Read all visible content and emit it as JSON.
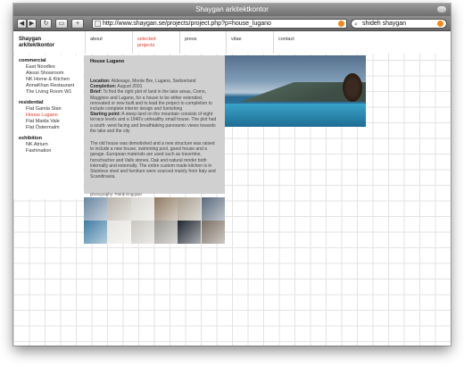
{
  "window": {
    "title": "Shaygan arkitektkontor"
  },
  "toolbar": {
    "back": "◀",
    "forward": "▶",
    "reload": "↻",
    "window_btn": "▭",
    "add": "+",
    "url": "http://www.shaygan.se/projects/project.php?p=house_lugano",
    "search": "shideh shaygan"
  },
  "nav": {
    "logo_line1": "Shaygan",
    "logo_line2": "arkitektkontor",
    "about": "about",
    "selected_line1": "selected",
    "selected_line2": "projects",
    "press": "press",
    "vitae": "vitae",
    "contact": "contact"
  },
  "sidebar": {
    "commercial": "commercial",
    "commercial_items": [
      "East Noodles",
      "Alessi Showroom",
      "NK Home & Kitchen",
      "AnnaKhan Restaurant",
      "The Living Room W1"
    ],
    "residential": "residential",
    "residential_items": [
      "Flat Gamla Stan",
      "House Lugano",
      "Flat Maida Vale",
      "Flat Östermalm"
    ],
    "exhibition": "exhibition",
    "exhibition_items": [
      "NK Atrium",
      "Fashination"
    ]
  },
  "project": {
    "title": "House Lugano",
    "location_label": "Location:",
    "location": "Aldesago, Monte Bre, Lugano, Switzerland",
    "completion_label": "Completion:",
    "completion": "August 2001",
    "brief_label": "Brief:",
    "brief": "To find the right plot of land in the lake areas, Como, Maggiore and Lugano, for a house to be either extended, renovated or new built and to lead the project to completion to include complete interior design and furnishing",
    "starting_label": "Starting point:",
    "starting": "A steep land on the mountain consists of eight terrace levels and a 1940's unhealthy small house. The plot had a south- west facing and breathtaking panoramic views towards the lake and the city",
    "description": "The old house was demolished and a new structure was raised to include a new house, swimming pool, guest house and a garage. European materials are used such as travertine, horschacher and Valls stones, Oak and natural render both internally and externally. The entire custom made kitchen is in Stainless steel and furniture were sourced mainly from Italy and Scandinavia.",
    "credit_label": "photography:",
    "credit": "Patrik Engquist"
  },
  "thumbnails": [
    {
      "name": "thumb-pool-view",
      "color": "#6a86a0"
    },
    {
      "name": "thumb-terrace",
      "color": "#b9b4aa"
    },
    {
      "name": "thumb-interior-white",
      "color": "#d9d7d2"
    },
    {
      "name": "thumb-kitchen",
      "color": "#8f7a62"
    },
    {
      "name": "thumb-living-room",
      "color": "#a89e8f"
    },
    {
      "name": "thumb-exterior-dusk",
      "color": "#5a6a7c"
    },
    {
      "name": "thumb-pool-blue",
      "color": "#3f7ca3"
    },
    {
      "name": "thumb-stairs",
      "color": "#e6e4df"
    },
    {
      "name": "thumb-facade",
      "color": "#c9c6c0"
    },
    {
      "name": "thumb-bathroom",
      "color": "#9b9893"
    },
    {
      "name": "thumb-night",
      "color": "#1f2630"
    },
    {
      "name": "thumb-detail",
      "color": "#7b6f63"
    }
  ]
}
